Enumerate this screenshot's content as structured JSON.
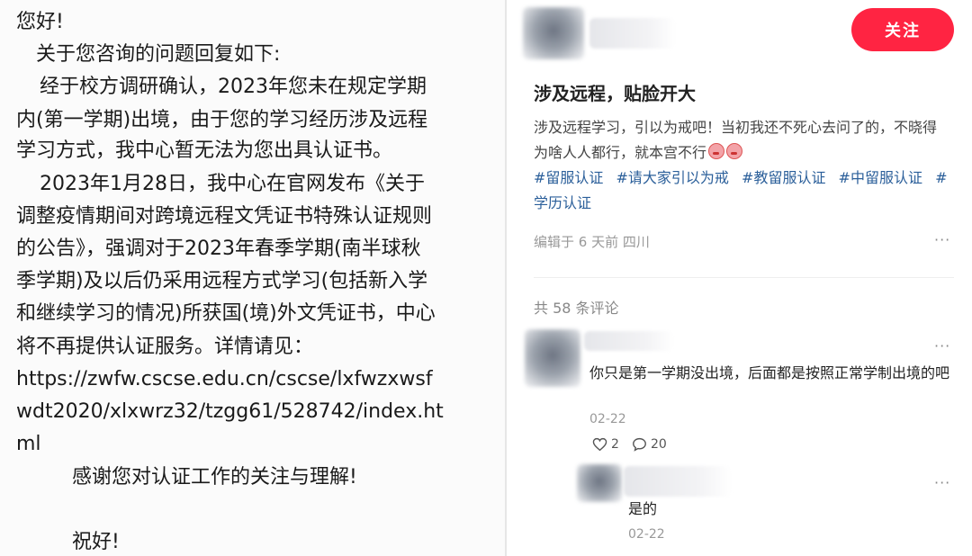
{
  "email": {
    "greeting": "您好!",
    "intro": "关于您咨询的问题回复如下:",
    "para1_line1": "经于校方调研确认，2023年您未在规定学期",
    "para1_line2": "内(第一学期)出境，由于您的学习经历涉及远程",
    "para1_line3": "学习方式，我中心暂无法为您出具认证书。",
    "para2_line1": "2023年1月28日，我中心在官网发布《关于",
    "para2_line2": "调整疫情期间对跨境远程文凭证书特殊认证规则",
    "para2_line3": "的公告》，强调对于2023年春季学期(南半球秋",
    "para2_line4": "季学期)及以后仍采用远程方式学习(包括新入学",
    "para2_line5": "和继续学习的情况)所获国(境)外文凭证书，中心",
    "para2_line6": "将不再提供认证服务。详情请见：",
    "url_line1": "https://zwfw.cscse.edu.cn/cscse/lxfwzxwsf",
    "url_line2": "wdt2020/xlxwrz32/tzgg61/528742/index.ht",
    "url_line3": "ml",
    "thanks": "感谢您对认证工作的关注与理解!",
    "closing": "祝好!"
  },
  "post": {
    "follow_label": "关注",
    "title": "涉及远程，贴脸开大",
    "body": "涉及远程学习，引以为戒吧！当初我还不死心去问了的，不晓得为啥人人都行，就本宫不行",
    "tags": [
      "#留服认证",
      "#请大家引以为戒",
      "#教留服认证",
      "#中留服认证",
      "#学历认证"
    ],
    "meta": "编辑于 6 天前 四川",
    "more_label": "···",
    "comment_count": "共 58 条评论"
  },
  "comments": [
    {
      "text": "你只是第一学期没出境，后面都是按照正常学制出境的吧",
      "date": "02-22",
      "likes": "2",
      "replies": "20"
    },
    {
      "text": "是的",
      "date": "02-22"
    }
  ],
  "colors": {
    "accent": "#ff2442",
    "tag": "#2b5f9a"
  }
}
